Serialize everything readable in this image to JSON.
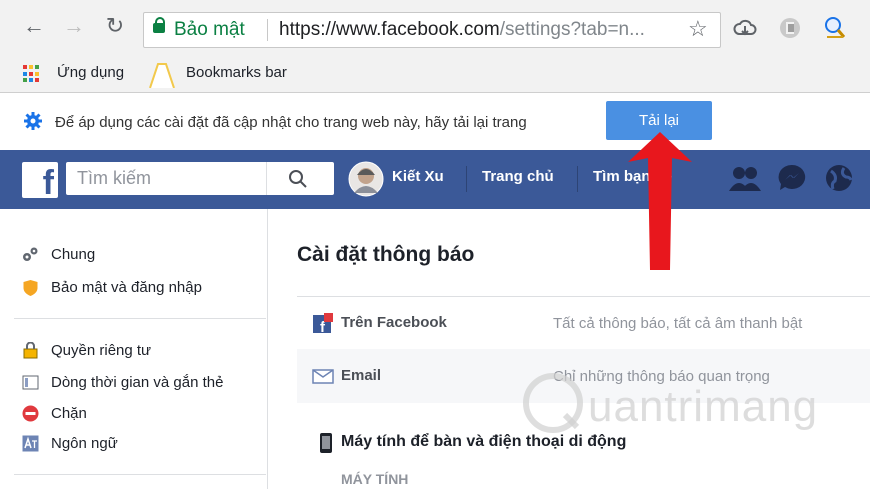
{
  "browser": {
    "secure_label": "Bảo mật",
    "url_main": "https://www.facebook.com",
    "url_rest": "/settings?tab=n...",
    "bookmarks": [
      "Ứng dụng",
      "Bookmarks bar"
    ]
  },
  "infobar": {
    "message": "Để áp dụng các cài đặt đã cập nhật cho trang web này, hãy tải lại trang",
    "reload_label": "Tải lại"
  },
  "fb_header": {
    "logo": "f",
    "search_placeholder": "Tìm kiếm",
    "user_name": "Kiết Xu",
    "home": "Trang chủ",
    "find_friends": "Tìm bạn bè"
  },
  "sidebar": {
    "group1": [
      "Chung",
      "Bảo mật và đăng nhập"
    ],
    "group2": [
      "Quyền riêng tư",
      "Dòng thời gian và gắn thẻ",
      "Chặn",
      "Ngôn ngữ"
    ]
  },
  "main": {
    "title": "Cài đặt thông báo",
    "rows": [
      {
        "label": "Trên Facebook",
        "value": "Tất cả thông báo, tất cả âm thanh bật"
      },
      {
        "label": "Email",
        "value": "Chỉ những thông báo quan trọng"
      }
    ],
    "section_title": "Máy tính để bàn và điện thoại di động",
    "subsection": "MÁY TÍNH"
  },
  "watermark": "uantrimang",
  "colors": {
    "fb_blue": "#3b5998",
    "button_blue": "#4a90e2",
    "arrow_red": "#e8171d",
    "secure_green": "#0b8043"
  }
}
